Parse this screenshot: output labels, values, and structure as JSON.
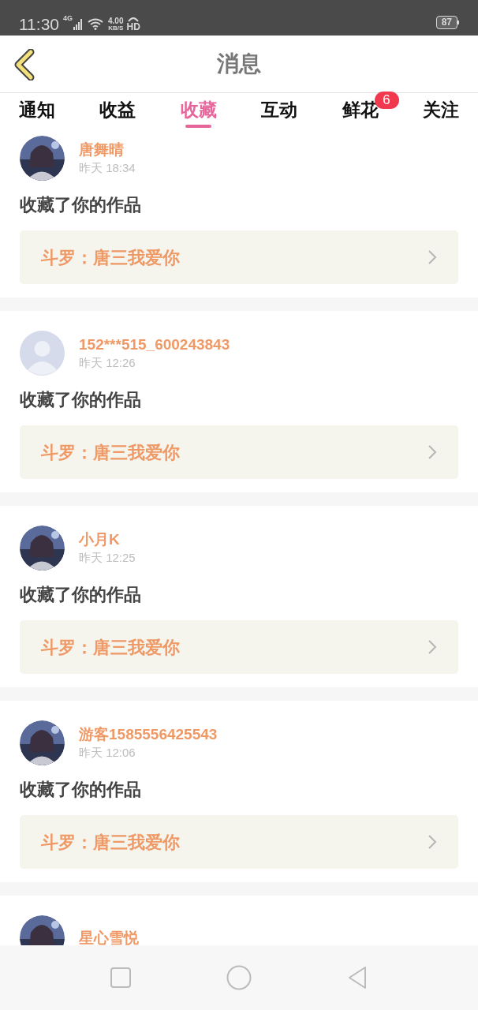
{
  "status_bar": {
    "time": "11:30",
    "network": "4G",
    "speed": "4.00",
    "speed_unit": "KB/S",
    "hd": "HD",
    "battery": "87"
  },
  "header": {
    "title": "消息"
  },
  "tabs": [
    {
      "label": "通知",
      "selected": false
    },
    {
      "label": "收益",
      "selected": false
    },
    {
      "label": "收藏",
      "selected": true
    },
    {
      "label": "互动",
      "selected": false
    },
    {
      "label": "鲜花",
      "selected": false,
      "badge": "6"
    },
    {
      "label": "关注",
      "selected": false
    }
  ],
  "messages": [
    {
      "name": "唐舞晴",
      "time": "昨天 18:34",
      "action": "收藏了你的作品",
      "work": "斗罗：唐三我爱你",
      "kind": "picture"
    },
    {
      "name": "152***515_600243843",
      "time": "昨天 12:26",
      "action": "收藏了你的作品",
      "work": "斗罗：唐三我爱你",
      "kind": "default"
    },
    {
      "name": "小月K",
      "time": "昨天 12:25",
      "action": "收藏了你的作品",
      "work": "斗罗：唐三我爱你",
      "kind": "picture"
    },
    {
      "name": "游客1585556425543",
      "time": "昨天 12:06",
      "action": "收藏了你的作品",
      "work": "斗罗：唐三我爱你",
      "kind": "picture"
    },
    {
      "name": "星心雪悦",
      "kind": "picture"
    }
  ]
}
